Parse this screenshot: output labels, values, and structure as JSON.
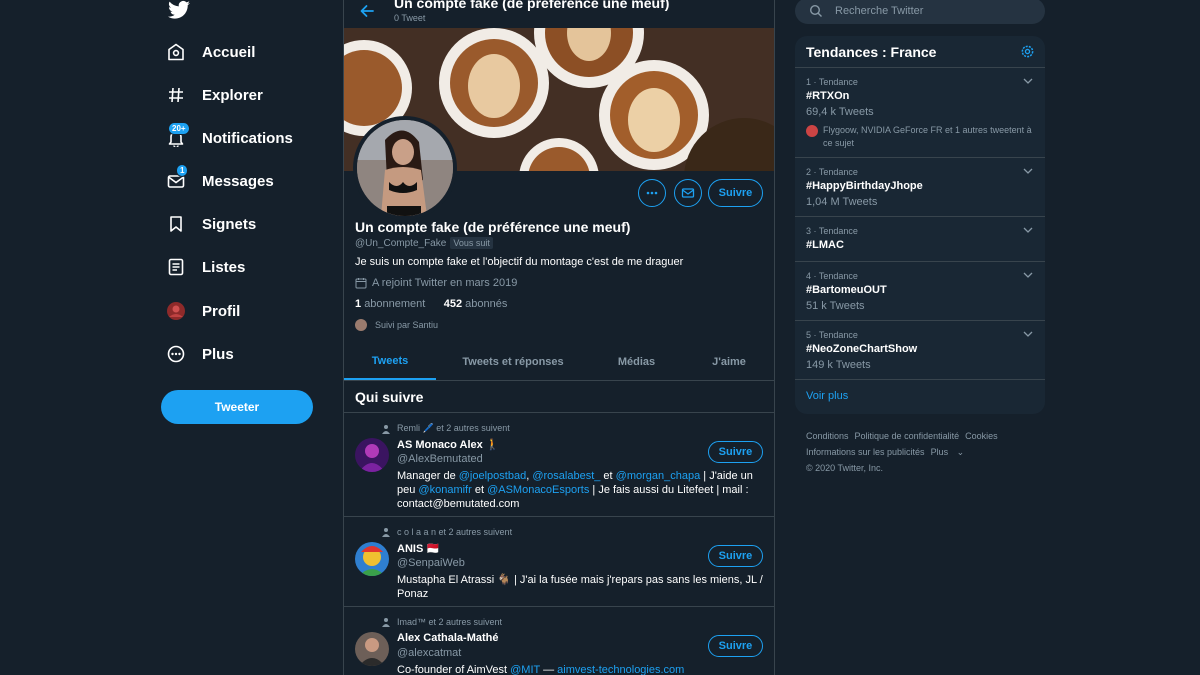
{
  "nav": {
    "items": [
      {
        "label": "Accueil",
        "icon": "home-icon"
      },
      {
        "label": "Explorer",
        "icon": "hashtag-icon"
      },
      {
        "label": "Notifications",
        "icon": "bell-icon",
        "badge": "20+"
      },
      {
        "label": "Messages",
        "icon": "envelope-icon",
        "badge": "1"
      },
      {
        "label": "Signets",
        "icon": "bookmark-icon"
      },
      {
        "label": "Listes",
        "icon": "list-icon"
      },
      {
        "label": "Profil",
        "icon": "avatar"
      },
      {
        "label": "Plus",
        "icon": "more-circle-icon"
      }
    ],
    "tweet_button": "Tweeter"
  },
  "header": {
    "title": "Un compte fake (de préférence une meuf)",
    "subtitle": "0 Tweet"
  },
  "profile": {
    "name": "Un compte fake (de préférence une meuf)",
    "handle": "@Un_Compte_Fake",
    "follows_you": "Vous suit",
    "bio": "Je suis un compte fake et l'objectif du montage c'est de me draguer",
    "joined": "A rejoint Twitter en mars 2019",
    "following_count": "1",
    "following_label": "abonnement",
    "followers_count": "452",
    "followers_label": "abonnés",
    "followed_by": "Suivi par Santiu",
    "follow_button": "Suivre"
  },
  "tabs": [
    {
      "label": "Tweets",
      "active": true
    },
    {
      "label": "Tweets et réponses",
      "active": false
    },
    {
      "label": "Médias",
      "active": false
    },
    {
      "label": "J'aime",
      "active": false
    }
  ],
  "who_to_follow": {
    "title": "Qui suivre",
    "items": [
      {
        "social": "Remli 🖊️ et 2 autres suivent",
        "name": "AS Monaco Alex 🚶",
        "handle": "@AlexBemutated",
        "button": "Suivre",
        "bio_parts": [
          {
            "t": "Manager de ",
            "link": false
          },
          {
            "t": "@joelpostbad",
            "link": true
          },
          {
            "t": ", ",
            "link": false
          },
          {
            "t": "@rosalabest_",
            "link": true
          },
          {
            "t": " et ",
            "link": false
          },
          {
            "t": "@morgan_chapa",
            "link": true
          },
          {
            "t": " | J'aide un peu ",
            "link": false
          },
          {
            "t": "@konamifr",
            "link": true
          },
          {
            "t": " et ",
            "link": false
          },
          {
            "t": "@ASMonacoEsports",
            "link": true
          },
          {
            "t": " | Je fais aussi du Litefeet | mail : contact@bemutated.com",
            "link": false
          }
        ]
      },
      {
        "social": "c o l a a n et 2 autres suivent",
        "name": "ANIS 🇲🇨",
        "handle": "@SenpaiWeb",
        "button": "Suivre",
        "bio_parts": [
          {
            "t": "Mustapha El Atrassi 🐐 | J'ai la fusée mais j'repars pas sans les miens, JL / Ponaz",
            "link": false
          }
        ]
      },
      {
        "social": "Imad™ et 2 autres suivent",
        "name": "Alex Cathala-Mathé",
        "handle": "@alexcatmat",
        "button": "Suivre",
        "bio_parts": [
          {
            "t": "Co-founder of AimVest ",
            "link": false
          },
          {
            "t": "@MIT",
            "link": true
          },
          {
            "t": " — ",
            "link": false
          },
          {
            "t": "aimvest-technologies.com",
            "link": true
          }
        ]
      }
    ]
  },
  "search": {
    "placeholder": "Recherche Twitter"
  },
  "trends": {
    "title": "Tendances : France",
    "items": [
      {
        "meta": "1 · Tendance",
        "name": "#RTXOn",
        "count": "69,4 k Tweets",
        "extra": "Flygoow, NVIDIA GeForce FR et 1 autres tweetent à ce sujet"
      },
      {
        "meta": "2 · Tendance",
        "name": "#HappyBirthdayJhope",
        "count": "1,04 M Tweets"
      },
      {
        "meta": "3 · Tendance",
        "name": "#LMAC",
        "count": ""
      },
      {
        "meta": "4 · Tendance",
        "name": "#BartomeuOUT",
        "count": "51 k Tweets"
      },
      {
        "meta": "5 · Tendance",
        "name": "#NeoZoneChartShow",
        "count": "149 k Tweets"
      }
    ],
    "see_more": "Voir plus"
  },
  "footer": {
    "links": [
      "Conditions",
      "Politique de confidentialité",
      "Cookies",
      "Informations sur les publicités",
      "Plus"
    ],
    "copyright": "© 2020 Twitter, Inc."
  },
  "colors": {
    "background": "#15202b",
    "accent": "#1da1f2",
    "card": "#192734",
    "muted": "#8899a6"
  }
}
